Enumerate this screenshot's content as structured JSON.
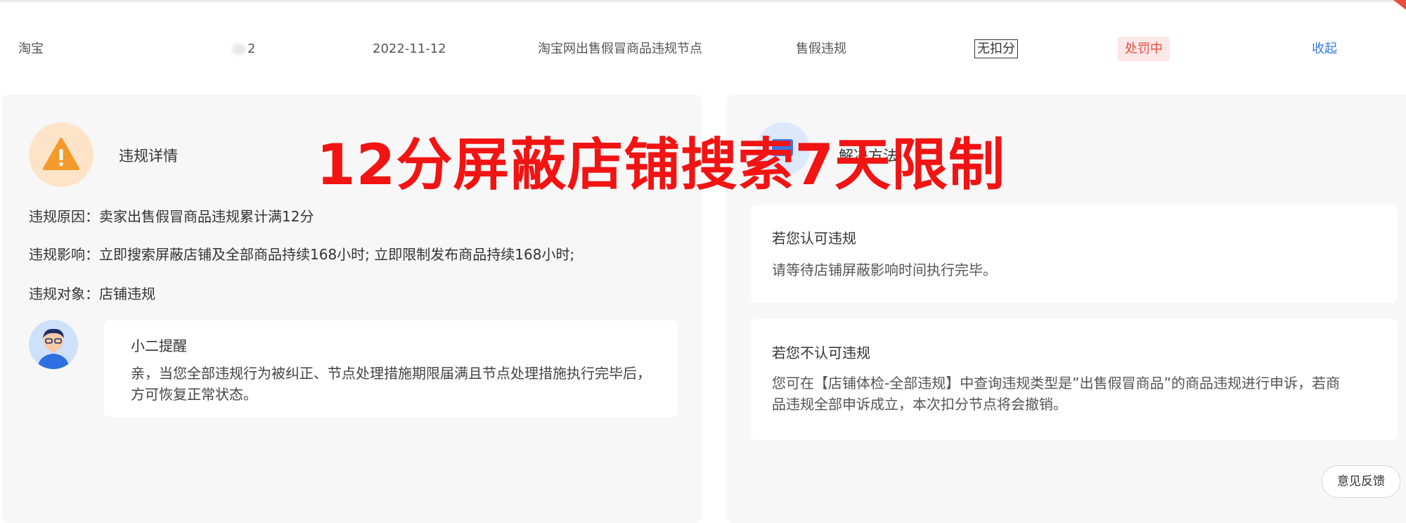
{
  "row": {
    "platform": "淘宝",
    "id_suffix": "2",
    "date": "2022-11-12",
    "node": "淘宝网出售假冒商品违规节点",
    "type": "售假违规",
    "score": "无扣分",
    "status": "处罚中",
    "toggle": "收起"
  },
  "left_panel": {
    "title": "违规详情",
    "reason_label": "违规原因：",
    "reason": "卖家出售假冒商品违规累计满12分",
    "impact_label": "违规影响：",
    "impact": "立即搜索屏蔽店铺及全部商品持续168小时; 立即限制发布商品持续168小时;",
    "target_label": "违规对象：",
    "target": "店铺违规",
    "tip_title": "小二提醒",
    "tip_text": "亲，当您全部违规行为被纠正、节点处理措施期限届满且节点处理措施执行完毕后，方可恢复正常状态。"
  },
  "right_panel": {
    "title": "解决方法",
    "card1_title": "若您认可违规",
    "card1_text": "请等待店铺屏蔽影响时间执行完毕。",
    "card2_title": "若您不认可违规",
    "card2_text": "您可在【店铺体检-全部违规】中查询违规类型是”出售假冒商品”的商品违规进行申诉，若商品违规全部申诉成立，本次扣分节点将会撤销。"
  },
  "feedback_label": "意见反馈",
  "overlay_text": "12分屏蔽店铺搜索7天限制",
  "colors": {
    "accent_red": "#f21313",
    "link_blue": "#2f7bea",
    "status_bg": "#fde7e8",
    "panel_bg": "#f7f7f7"
  },
  "icons": {
    "warning": "warning-icon",
    "avatar": "assistant-avatar",
    "solution": "solution-icon"
  }
}
